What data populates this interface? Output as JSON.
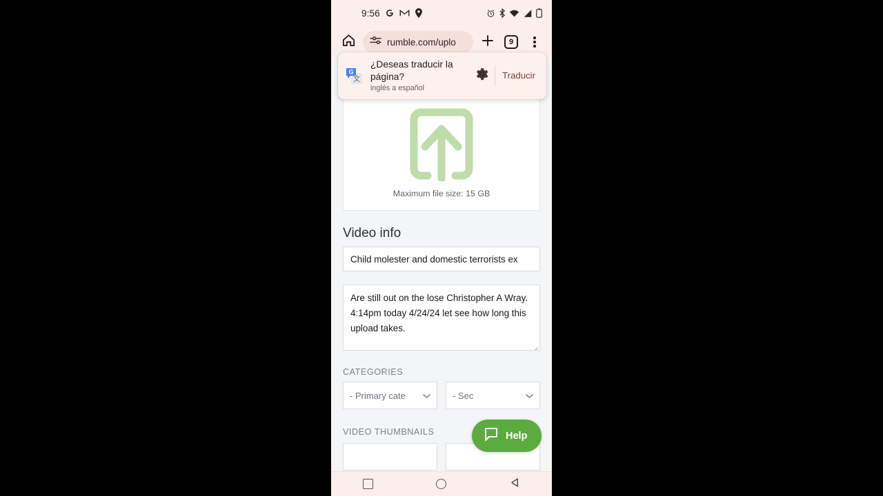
{
  "statusbar": {
    "time": "9:56",
    "icons_left": [
      "google-g-icon",
      "gmail-icon",
      "location-pin-icon"
    ],
    "icons_right": [
      "alarm-icon",
      "bluetooth-icon",
      "wifi-icon",
      "cell-signal-icon",
      "battery-icon"
    ]
  },
  "browser": {
    "home_icon": "home-icon",
    "site_settings_icon": "tune-sliders-icon",
    "url": "rumble.com/uplo",
    "new_tab_icon": "plus-icon",
    "tab_count": "9",
    "menu_icon": "overflow-menu-icon"
  },
  "translate_popup": {
    "icon": "google-translate-icon",
    "title": "¿Deseas traducir la página?",
    "subtitle": "inglés a español",
    "settings_icon": "gear-icon",
    "action_label": "Traducir"
  },
  "page": {
    "upload": {
      "icon": "upload-arrow-icon",
      "caption": "Maximum file size: 15 GB"
    },
    "video_info": {
      "heading": "Video info",
      "title_value": "Child molester and domestic terrorists ex",
      "description_value": "Are still out on the lose Christopher A Wray. 4:14pm today 4/24/24 let see how long this upload takes."
    },
    "categories": {
      "label": "CATEGORIES",
      "primary_value": "- Primary cate",
      "secondary_value": "- Sec",
      "chevron_icon": "chevron-down-icon"
    },
    "thumbnails": {
      "label": "VIDEO THUMBNAILS"
    }
  },
  "help_fab": {
    "icon": "chat-bubble-icon",
    "label": "Help"
  },
  "navbar": {
    "recents_icon": "square-recents-icon",
    "home_icon": "circle-home-icon",
    "back_icon": "triangle-back-icon"
  },
  "colors": {
    "chrome_bg": "#fbeeeb",
    "page_bg": "#f3f5f7",
    "upload_icon_green": "#b9dba2",
    "help_green": "#5cab3f",
    "translate_action": "#7d3f35"
  }
}
